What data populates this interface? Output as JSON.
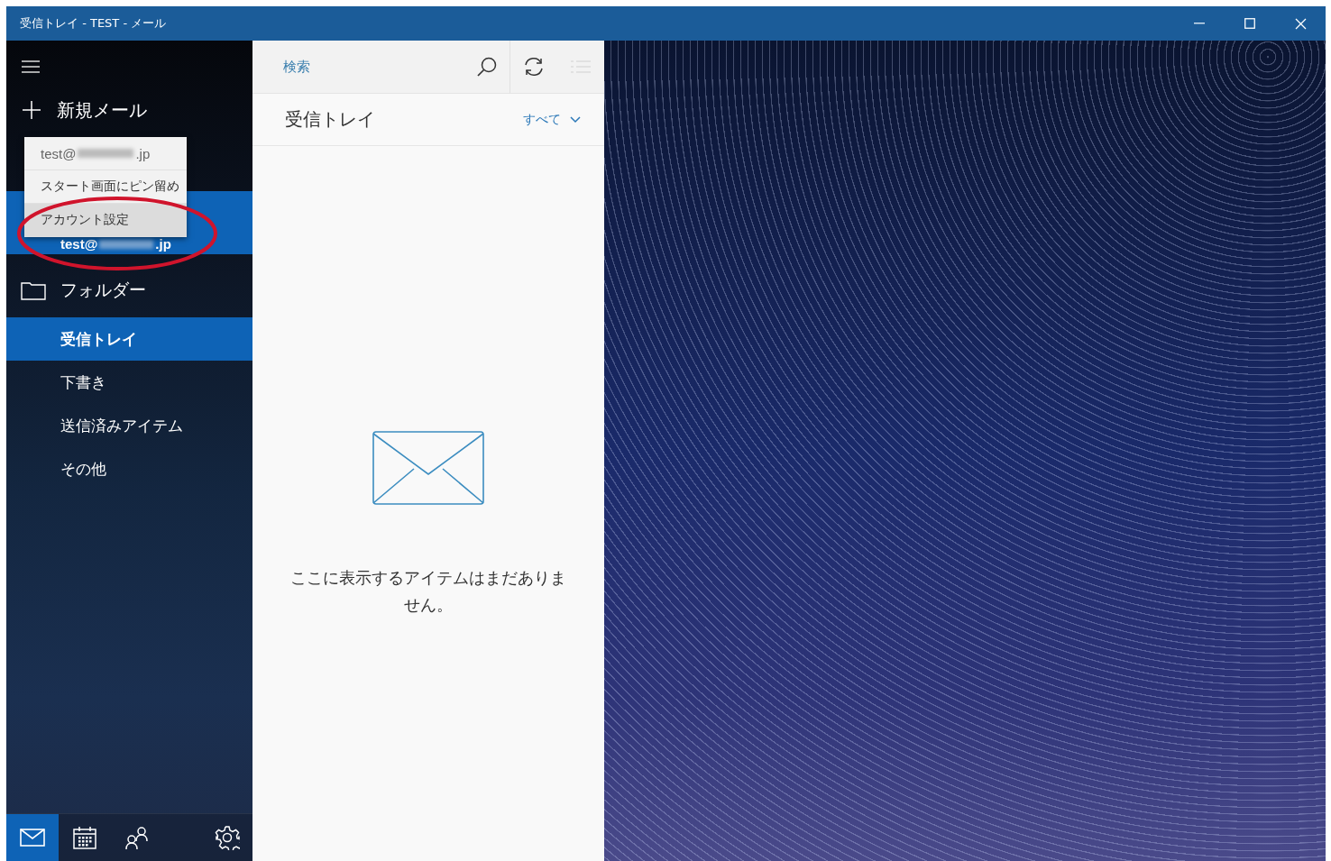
{
  "window": {
    "title": "受信トレイ - TEST - メール"
  },
  "sidebar": {
    "new_mail": "新規メール",
    "account": {
      "email_start": "test@",
      "email_end": ".jp",
      "selected": true
    },
    "context_menu": [
      {
        "kind": "account",
        "label": "test@",
        "suffix": ".jp",
        "selected": false
      },
      {
        "kind": "action",
        "label": "スタート画面にピン留め",
        "selected": false
      },
      {
        "kind": "action",
        "label": "アカウント設定",
        "selected": true
      }
    ],
    "folders_heading": "フォルダー",
    "folders": [
      {
        "label": "受信トレイ",
        "selected": true
      },
      {
        "label": "下書き",
        "selected": false
      },
      {
        "label": "送信済みアイテム",
        "selected": false
      },
      {
        "label": "その他",
        "selected": false
      }
    ],
    "bottom_nav": [
      {
        "kind": "mail",
        "selected": true
      },
      {
        "kind": "calendar",
        "selected": false
      },
      {
        "kind": "people",
        "selected": false
      },
      {
        "kind": "settings",
        "selected": false
      }
    ]
  },
  "message_list": {
    "search": {
      "placeholder": "検索"
    },
    "title": "受信トレイ",
    "filter": "すべて",
    "empty_message": "ここに表示するアイテムはまだありません。"
  }
}
